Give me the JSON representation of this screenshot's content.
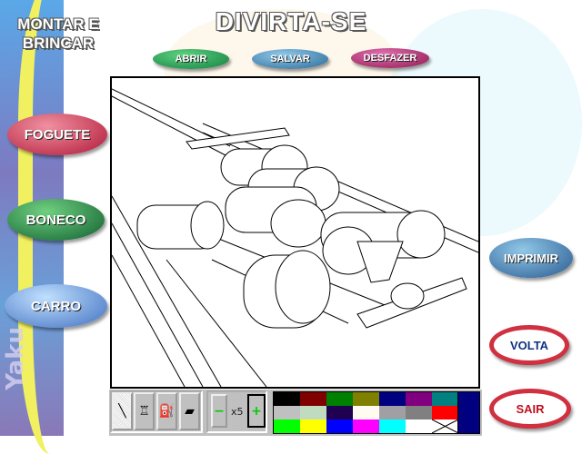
{
  "header": {
    "app_title": "MONTAR E BRINCAR",
    "main_title": "DIVIRTA-SE",
    "watermark": "Yaku"
  },
  "top_buttons": {
    "open": "ABRIR",
    "save": "SALVAR",
    "undo": "DESFAZER"
  },
  "left_buttons": {
    "rocket": "FOGUETE",
    "doll": "BONECO",
    "car": "CARRO"
  },
  "right_buttons": {
    "print": "IMPRIMIR",
    "back": "VOLTA",
    "exit": "SAIR"
  },
  "toolbar": {
    "tools": [
      "pencil-icon",
      "spray-icon",
      "paint-bucket-icon",
      "eraser-icon"
    ],
    "minus": "−",
    "plus": "+",
    "size": "x5"
  },
  "palette": {
    "colors": [
      "#000000",
      "#800000",
      "#008000",
      "#808000",
      "#000080",
      "#800080",
      "#008080",
      "#c0c0c0",
      "#c0dcc0",
      "#200050",
      "#fffbf0",
      "#a0a0a4",
      "#808080",
      "#ff0000",
      "#00ff00",
      "#ffff00",
      "#0000ff",
      "#ff00ff",
      "#00ffff",
      "#ffffff",
      "transparent"
    ],
    "current": "#000080"
  }
}
